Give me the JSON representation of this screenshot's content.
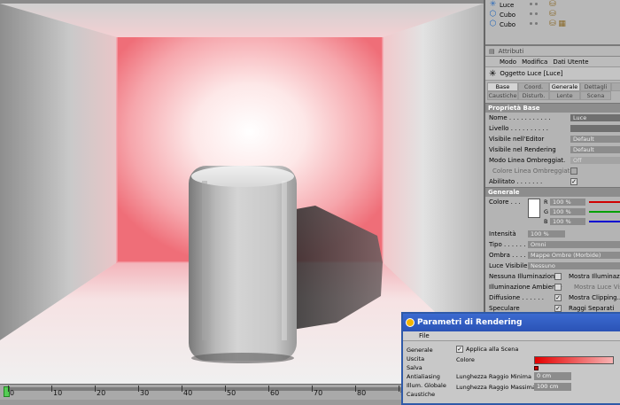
{
  "timeline": {
    "labels": [
      "0",
      "10",
      "20",
      "30",
      "40",
      "50",
      "60",
      "70",
      "80",
      "90"
    ],
    "current_frame": "0"
  },
  "objects": {
    "items": [
      {
        "name": "Luce",
        "icon": "light-icon"
      },
      {
        "name": "Cubo",
        "icon": "cube-icon"
      },
      {
        "name": "Cubo",
        "icon": "cube-icon"
      }
    ]
  },
  "attributes": {
    "title": "Attributi",
    "menu": [
      "Modo",
      "Modifica",
      "Dati Utente"
    ],
    "object_header": "Oggetto Luce [Luce]",
    "tabs_row1": [
      "Base",
      "Coord.",
      "Generale",
      "Dettagli",
      "Vi"
    ],
    "tabs_row2": [
      "Caustiche",
      "Disturb.",
      "Lente",
      "Scena"
    ],
    "active_tabs": [
      "Base",
      "Generale"
    ]
  },
  "base": {
    "section": "Proprietà Base",
    "rows": [
      {
        "label": "Nome . . . . . . . . . . .",
        "value": "Luce"
      },
      {
        "label": "Livello . . . . . . . . . .",
        "value": ""
      },
      {
        "label": "Visibile nell'Editor",
        "value": "Default"
      },
      {
        "label": "Visibile nel Rendering",
        "value": "Default"
      },
      {
        "label": "Modo Linea Ombreggiat.",
        "value": "Off"
      },
      {
        "label": "Colore Linea Ombreggiata",
        "value": ""
      },
      {
        "label": "Abilitato . . . . . . .",
        "value": "✓"
      }
    ]
  },
  "general": {
    "section": "Generale",
    "color_label": "Colore . . .",
    "color_channels": [
      {
        "ch": "R",
        "value": "100 %",
        "color": "#d00000"
      },
      {
        "ch": "G",
        "value": "100 %",
        "color": "#00a000"
      },
      {
        "ch": "B",
        "value": "100 %",
        "color": "#0000d0"
      }
    ],
    "intensity_label": "Intensità",
    "intensity_value": "100 %",
    "type_label": "Tipo . . . . . . .",
    "type_value": "Omni",
    "shadow_label": "Ombra . . . . . .",
    "shadow_value": "Mappe Ombre (Morbide)",
    "visible_label": "Luce Visibile",
    "visible_value": "Nessuno",
    "checks": [
      {
        "left": "Nessuna Illuminazione",
        "right": "Mostra Illuminazi..."
      },
      {
        "left": "Illuminazione Ambiente",
        "right": "Mostra Luce Visib..."
      },
      {
        "left": "Diffusione . . . . . .",
        "right": "Mostra Clipping..."
      },
      {
        "left": "Speculare",
        "right": "Raggi Separati"
      }
    ]
  },
  "render_dialog": {
    "title": "Parametri di Rendering",
    "menu": "File",
    "nav": [
      "Generale",
      "Uscita",
      "Salva",
      "Antialiasing",
      "Illum. Globale",
      "Caustiche"
    ],
    "apply_scene": "Applica alla Scena",
    "color_label": "Colore",
    "min_ray_label": "Lunghezza Raggio Minima",
    "min_ray_value": "0 cm",
    "max_ray_label": "Lunghezza Raggio Massima",
    "max_ray_value": "100 cm"
  }
}
